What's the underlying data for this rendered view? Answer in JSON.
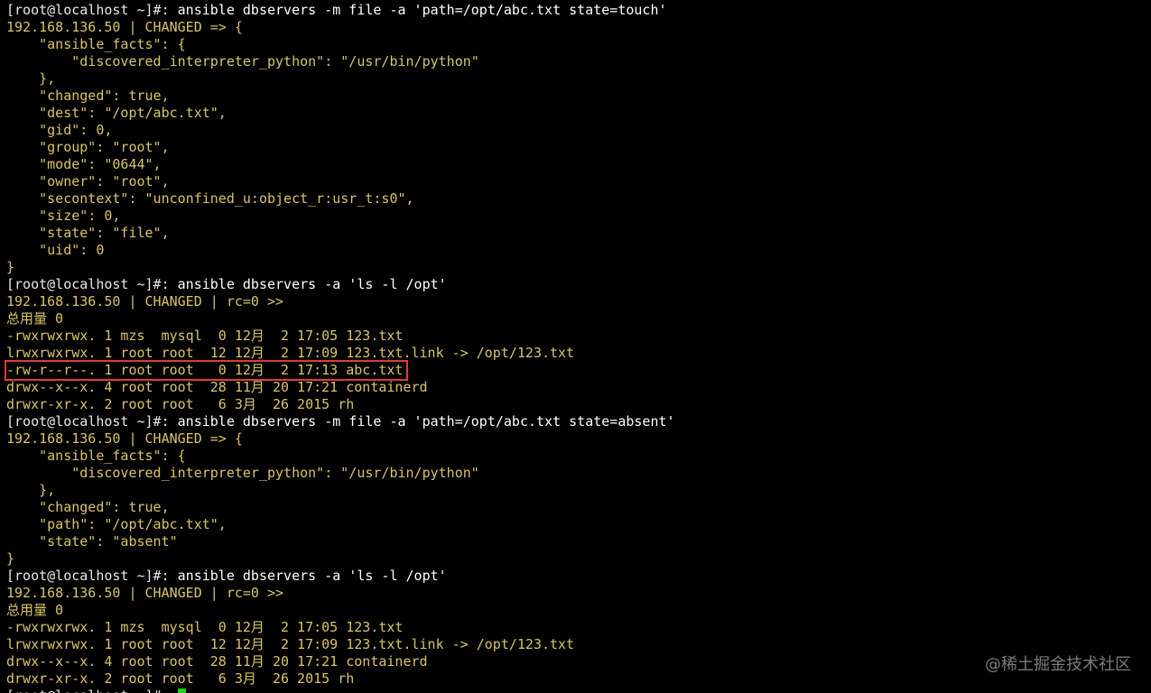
{
  "colors": {
    "background": "#000000",
    "output_text": "#d9c46a",
    "prompt_text": "#e8e8e8",
    "highlight_border": "#e03a3a",
    "cursor": "#1fd21f"
  },
  "terminal": {
    "lines": [
      {
        "prompt": "[root@localhost ~]#: ",
        "cmd": "ansible dbservers -m file -a 'path=/opt/abc.txt state=touch'"
      },
      {
        "text": "192.168.136.50 | CHANGED => {"
      },
      {
        "text": "    \"ansible_facts\": {"
      },
      {
        "text": "        \"discovered_interpreter_python\": \"/usr/bin/python\""
      },
      {
        "text": "    },"
      },
      {
        "text": "    \"changed\": true,"
      },
      {
        "text": "    \"dest\": \"/opt/abc.txt\","
      },
      {
        "text": "    \"gid\": 0,"
      },
      {
        "text": "    \"group\": \"root\","
      },
      {
        "text": "    \"mode\": \"0644\","
      },
      {
        "text": "    \"owner\": \"root\","
      },
      {
        "text": "    \"secontext\": \"unconfined_u:object_r:usr_t:s0\","
      },
      {
        "text": "    \"size\": 0,"
      },
      {
        "text": "    \"state\": \"file\","
      },
      {
        "text": "    \"uid\": 0"
      },
      {
        "text": "}"
      },
      {
        "prompt": "[root@localhost ~]#: ",
        "cmd": "ansible dbservers -a 'ls -l /opt'"
      },
      {
        "text": "192.168.136.50 | CHANGED | rc=0 >>"
      },
      {
        "text": "总用量 0"
      },
      {
        "text": "-rwxrwxrwx. 1 mzs  mysql  0 12月  2 17:05 123.txt"
      },
      {
        "text": "lrwxrwxrwx. 1 root root  12 12月  2 17:09 123.txt.link -> /opt/123.txt"
      },
      {
        "text": "-rw-r--r--. 1 root root   0 12月  2 17:13 abc.txt",
        "highlight": true
      },
      {
        "text": "drwx--x--x. 4 root root  28 11月 20 17:21 containerd"
      },
      {
        "text": "drwxr-xr-x. 2 root root   6 3月  26 2015 rh"
      },
      {
        "prompt": "[root@localhost ~]#: ",
        "cmd": "ansible dbservers -m file -a 'path=/opt/abc.txt state=absent'"
      },
      {
        "text": "192.168.136.50 | CHANGED => {"
      },
      {
        "text": "    \"ansible_facts\": {"
      },
      {
        "text": "        \"discovered_interpreter_python\": \"/usr/bin/python\""
      },
      {
        "text": "    },"
      },
      {
        "text": "    \"changed\": true,"
      },
      {
        "text": "    \"path\": \"/opt/abc.txt\","
      },
      {
        "text": "    \"state\": \"absent\""
      },
      {
        "text": "}"
      },
      {
        "prompt": "[root@localhost ~]#: ",
        "cmd": "ansible dbservers -a 'ls -l /opt'"
      },
      {
        "text": "192.168.136.50 | CHANGED | rc=0 >>"
      },
      {
        "text": "总用量 0"
      },
      {
        "text": "-rwxrwxrwx. 1 mzs  mysql  0 12月  2 17:05 123.txt"
      },
      {
        "text": "lrwxrwxrwx. 1 root root  12 12月  2 17:09 123.txt.link -> /opt/123.txt"
      },
      {
        "text": "drwx--x--x. 4 root root  28 11月 20 17:21 containerd"
      },
      {
        "text": "drwxr-xr-x. 2 root root   6 3月  26 2015 rh"
      },
      {
        "prompt": "[root@localhost ~]#: ",
        "cmd": "",
        "cursor": true
      }
    ]
  },
  "watermark": "@稀土掘金技术社区"
}
